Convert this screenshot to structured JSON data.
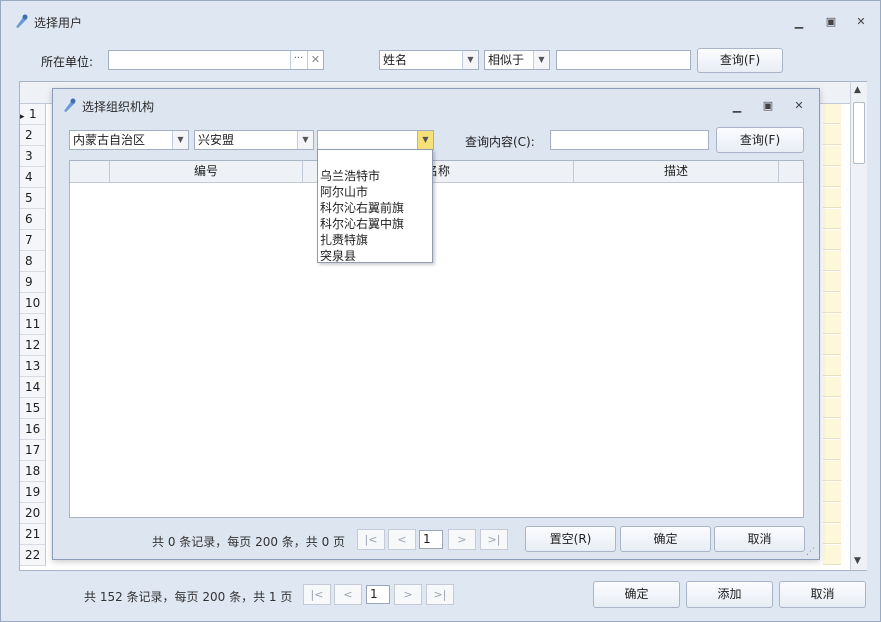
{
  "main": {
    "title": "选择用户",
    "unit_label": "所在单位:",
    "unit_value": "",
    "field_select": "姓名",
    "op_select": "相似于",
    "search_value": "",
    "query_button": "查询(F)",
    "row_numbers": [
      "1",
      "2",
      "3",
      "4",
      "5",
      "6",
      "7",
      "8",
      "9",
      "10",
      "11",
      "12",
      "13",
      "14",
      "15",
      "16",
      "17",
      "18",
      "19",
      "20",
      "21",
      "22"
    ],
    "pager_text": "共 152 条记录，每页 200 条，共 1 页",
    "page": "1",
    "confirm": "确定",
    "add": "添加",
    "cancel": "取消"
  },
  "dialog": {
    "title": "选择组织机构",
    "province": "内蒙古自治区",
    "league": "兴安盟",
    "county": "",
    "query_label": "查询内容(C):",
    "query_value": "",
    "query_button": "查询(F)",
    "columns": [
      "编号",
      "名称",
      "描述"
    ],
    "dropdown_options": [
      "乌兰浩特市",
      "阿尔山市",
      "科尔沁右翼前旗",
      "科尔沁右翼中旗",
      "扎赉特旗",
      "突泉县"
    ],
    "pager_text": "共 0 条记录，每页 200 条，共 0 页",
    "page": "1",
    "clear": "置空(R)",
    "confirm": "确定",
    "cancel": "取消"
  },
  "colors": {
    "window_bg": "#dfe7f3",
    "accent": "#f5e07a",
    "grid_yellow": "#fdf8d9"
  }
}
